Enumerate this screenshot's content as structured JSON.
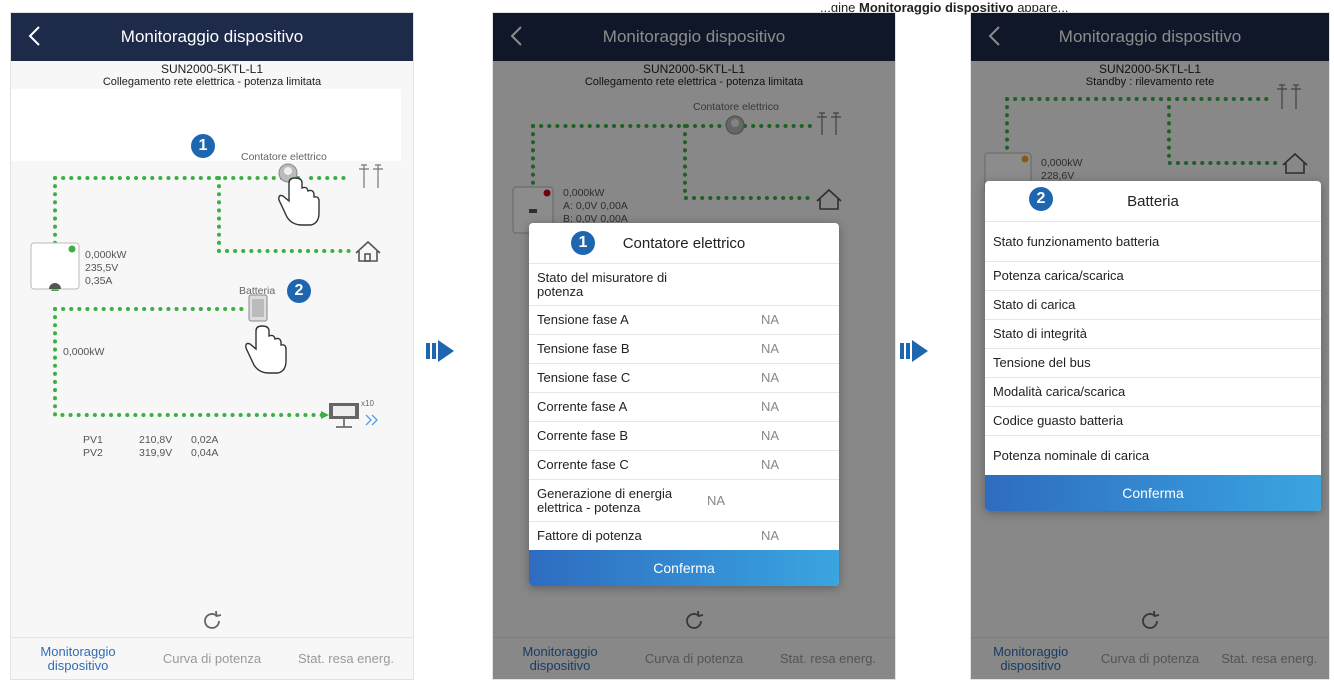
{
  "doc_snippet": {
    "before": "...gine ",
    "bold": "Monitoraggio dispositivo",
    "after": " appare..."
  },
  "common": {
    "title": "Monitoraggio dispositivo",
    "model": "SUN2000-5KTL-L1",
    "nav": [
      "Monitoraggio dispositivo",
      "Curva di potenza",
      "Stat. resa energ."
    ]
  },
  "screen1": {
    "status": "Collegamento rete elettrica - potenza limitata",
    "meter_label": "Contatore elettrico",
    "battery_label": "Batteria",
    "inverter": {
      "power": "0,000kW",
      "voltage": "235,5V",
      "current": "0,35A"
    },
    "battery_power": "0,000kW",
    "pv": [
      {
        "name": "PV1",
        "voltage": "210,8V",
        "current": "0,02A"
      },
      {
        "name": "PV2",
        "voltage": "319,9V",
        "current": "0,04A"
      }
    ],
    "pv_count": "x10",
    "badge1": "1",
    "badge2": "2"
  },
  "screen2": {
    "status": "Collegamento rete elettrica - potenza limitata",
    "meter_label": "Contatore elettrico",
    "inverter_power": "0,000kW",
    "inverter_phase_a": "A: 0,0V 0,00A",
    "inverter_phase_b": "B: 0,0V 0,00A",
    "dialog": {
      "badge": "1",
      "title": "Contatore elettrico",
      "rows": [
        {
          "k": "Stato del misuratore di potenza",
          "v": ""
        },
        {
          "k": "Tensione fase A",
          "v": "NA"
        },
        {
          "k": "Tensione fase B",
          "v": "NA"
        },
        {
          "k": "Tensione fase C",
          "v": "NA"
        },
        {
          "k": "Corrente fase A",
          "v": "NA"
        },
        {
          "k": "Corrente fase B",
          "v": "NA"
        },
        {
          "k": "Corrente fase C",
          "v": "NA"
        },
        {
          "k": "Generazione di energia elettrica - potenza",
          "v": "NA"
        },
        {
          "k": "Fattore di potenza",
          "v": "NA"
        }
      ],
      "confirm": "Conferma"
    }
  },
  "screen3": {
    "status": "Standby : rilevamento rete",
    "inverter_power": "0,000kW",
    "inverter_voltage": "228,6V",
    "dialog": {
      "badge": "2",
      "title": "Batteria",
      "rows": [
        {
          "k": "Stato funzionamento batteria"
        },
        {
          "k": "Potenza carica/scarica"
        },
        {
          "k": "Stato di carica"
        },
        {
          "k": "Stato di integrità"
        },
        {
          "k": "Tensione del bus"
        },
        {
          "k": "Modalità carica/scarica"
        },
        {
          "k": "Codice guasto batteria"
        },
        {
          "k": "Potenza nominale di carica"
        }
      ],
      "confirm": "Conferma"
    }
  },
  "icons": {
    "back": "chevron-left-icon",
    "pylon": "power-pylon-icon",
    "home": "house-icon",
    "meter": "meter-icon",
    "battery": "battery-icon",
    "pv": "solar-panel-icon",
    "hand": "hand-pointer-icon",
    "refresh": "refresh-icon",
    "next": "arrow-right-icon"
  },
  "colors": {
    "topbar": "#1e2a4a",
    "flow": "#3cb043",
    "accent": "#2f6db5",
    "badge": "#1e66b0"
  }
}
